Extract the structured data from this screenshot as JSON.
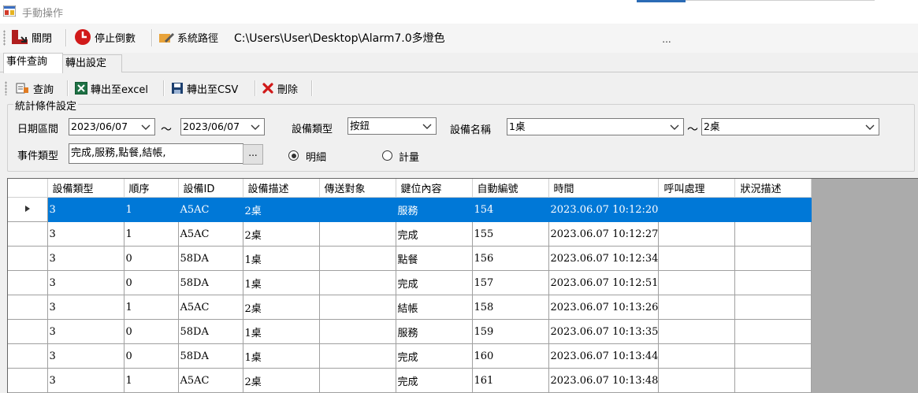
{
  "window": {
    "title": "手動操作"
  },
  "toolbar": {
    "close_label": "關閉",
    "stop_countdown_label": "停止倒數",
    "system_path_label": "系統路徑",
    "system_path_value": "C:\\Users\\User\\Desktop\\Alarm7.0多燈色",
    "browse_label": "..."
  },
  "tabs": [
    {
      "label": "事件查詢",
      "active": true
    },
    {
      "label": "轉出設定",
      "active": false
    }
  ],
  "actions": {
    "query_label": "查詢",
    "export_excel_label": "轉出至excel",
    "export_csv_label": "轉出至CSV",
    "delete_label": "刪除"
  },
  "filters": {
    "group_label": "統計條件設定",
    "date_range_label": "日期區間",
    "date_from": "2023/06/07",
    "tilde": "～",
    "date_to": "2023/06/07",
    "device_type_label": "設備類型",
    "device_type_value": "按鈕",
    "device_name_label": "設備名稱",
    "device_name_from": "1桌",
    "device_name_to": "2桌",
    "event_type_label": "事件類型",
    "event_type_value": "完成,服務,點餐,結帳,",
    "event_type_button": "...",
    "radio_detail_label": "明細",
    "radio_count_label": "計量",
    "selected_mode": "detail"
  },
  "grid": {
    "columns": [
      "設備類型",
      "順序",
      "設備ID",
      "設備描述",
      "傳送對象",
      "鍵位內容",
      "自動編號",
      "時間",
      "呼叫處理",
      "狀況描述"
    ],
    "rows": [
      [
        "3",
        "1",
        "A5AC",
        "2桌",
        "",
        "服務",
        "154",
        "2023.06.07 10:12:20",
        "",
        ""
      ],
      [
        "3",
        "1",
        "A5AC",
        "2桌",
        "",
        "完成",
        "155",
        "2023.06.07 10:12:27",
        "",
        ""
      ],
      [
        "3",
        "0",
        "58DA",
        "1桌",
        "",
        "點餐",
        "156",
        "2023.06.07 10:12:34",
        "",
        ""
      ],
      [
        "3",
        "0",
        "58DA",
        "1桌",
        "",
        "完成",
        "157",
        "2023.06.07 10:12:51",
        "",
        ""
      ],
      [
        "3",
        "1",
        "A5AC",
        "2桌",
        "",
        "結帳",
        "158",
        "2023.06.07 10:13:26",
        "",
        ""
      ],
      [
        "3",
        "0",
        "58DA",
        "1桌",
        "",
        "服務",
        "159",
        "2023.06.07 10:13:35",
        "",
        ""
      ],
      [
        "3",
        "0",
        "58DA",
        "1桌",
        "",
        "完成",
        "160",
        "2023.06.07 10:13:44",
        "",
        ""
      ],
      [
        "3",
        "1",
        "A5AC",
        "2桌",
        "",
        "完成",
        "161",
        "2023.06.07 10:13:48",
        "",
        ""
      ]
    ],
    "selected_row": 0,
    "selection_color": "#0078d7"
  },
  "icons": {
    "app": "app-window-icon",
    "close": "exit-door-icon",
    "stop": "stop-clock-icon",
    "path": "pencil-folder-icon",
    "query": "query-table-icon",
    "excel": "excel-icon",
    "csv": "floppy-disk-icon",
    "delete": "red-x-icon",
    "row_pointer": "row-pointer-icon"
  }
}
